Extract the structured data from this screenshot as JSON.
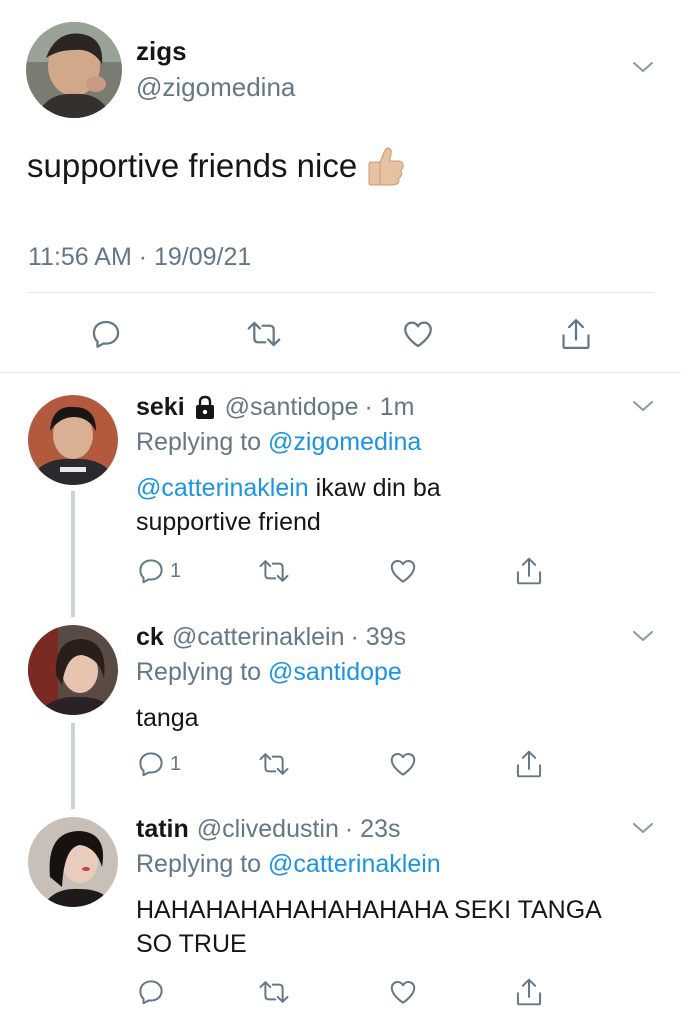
{
  "main_tweet": {
    "name": "zigs",
    "handle": "@zigomedina",
    "text": "supportive friends nice",
    "emoji": "thumbs-up",
    "timestamp": "11:56 AM · 19/09/21"
  },
  "replies": [
    {
      "name": "seki",
      "handle": "@santidope",
      "time": "· 1m",
      "locked": true,
      "replying_prefix": "Replying to ",
      "replying_to": "@zigomedina",
      "mention": "@catterinaklein",
      "text_after_mention": " ikaw din ba",
      "text_line2": "supportive friend",
      "reply_count": "1"
    },
    {
      "name": "ck",
      "handle": "@catterinaklein",
      "time": "· 39s",
      "replying_prefix": "Replying to ",
      "replying_to": "@santidope",
      "text": "tanga",
      "reply_count": "1"
    },
    {
      "name": "tatin",
      "handle": "@clivedustin",
      "time": "· 23s",
      "replying_prefix": "Replying to ",
      "replying_to": "@catterinaklein",
      "text_line1": "HAHAHAHAHAHAHAHAHA SEKI TANGA",
      "text_line2": "SO TRUE"
    }
  ],
  "colors": {
    "link": "#1b95e0",
    "secondary": "#657786",
    "divider": "#e1e8ed",
    "thread_line": "#c8d2da"
  },
  "icons": [
    "reply-icon",
    "retweet-icon",
    "like-icon",
    "share-icon",
    "chevron-down-icon",
    "lock-icon"
  ]
}
